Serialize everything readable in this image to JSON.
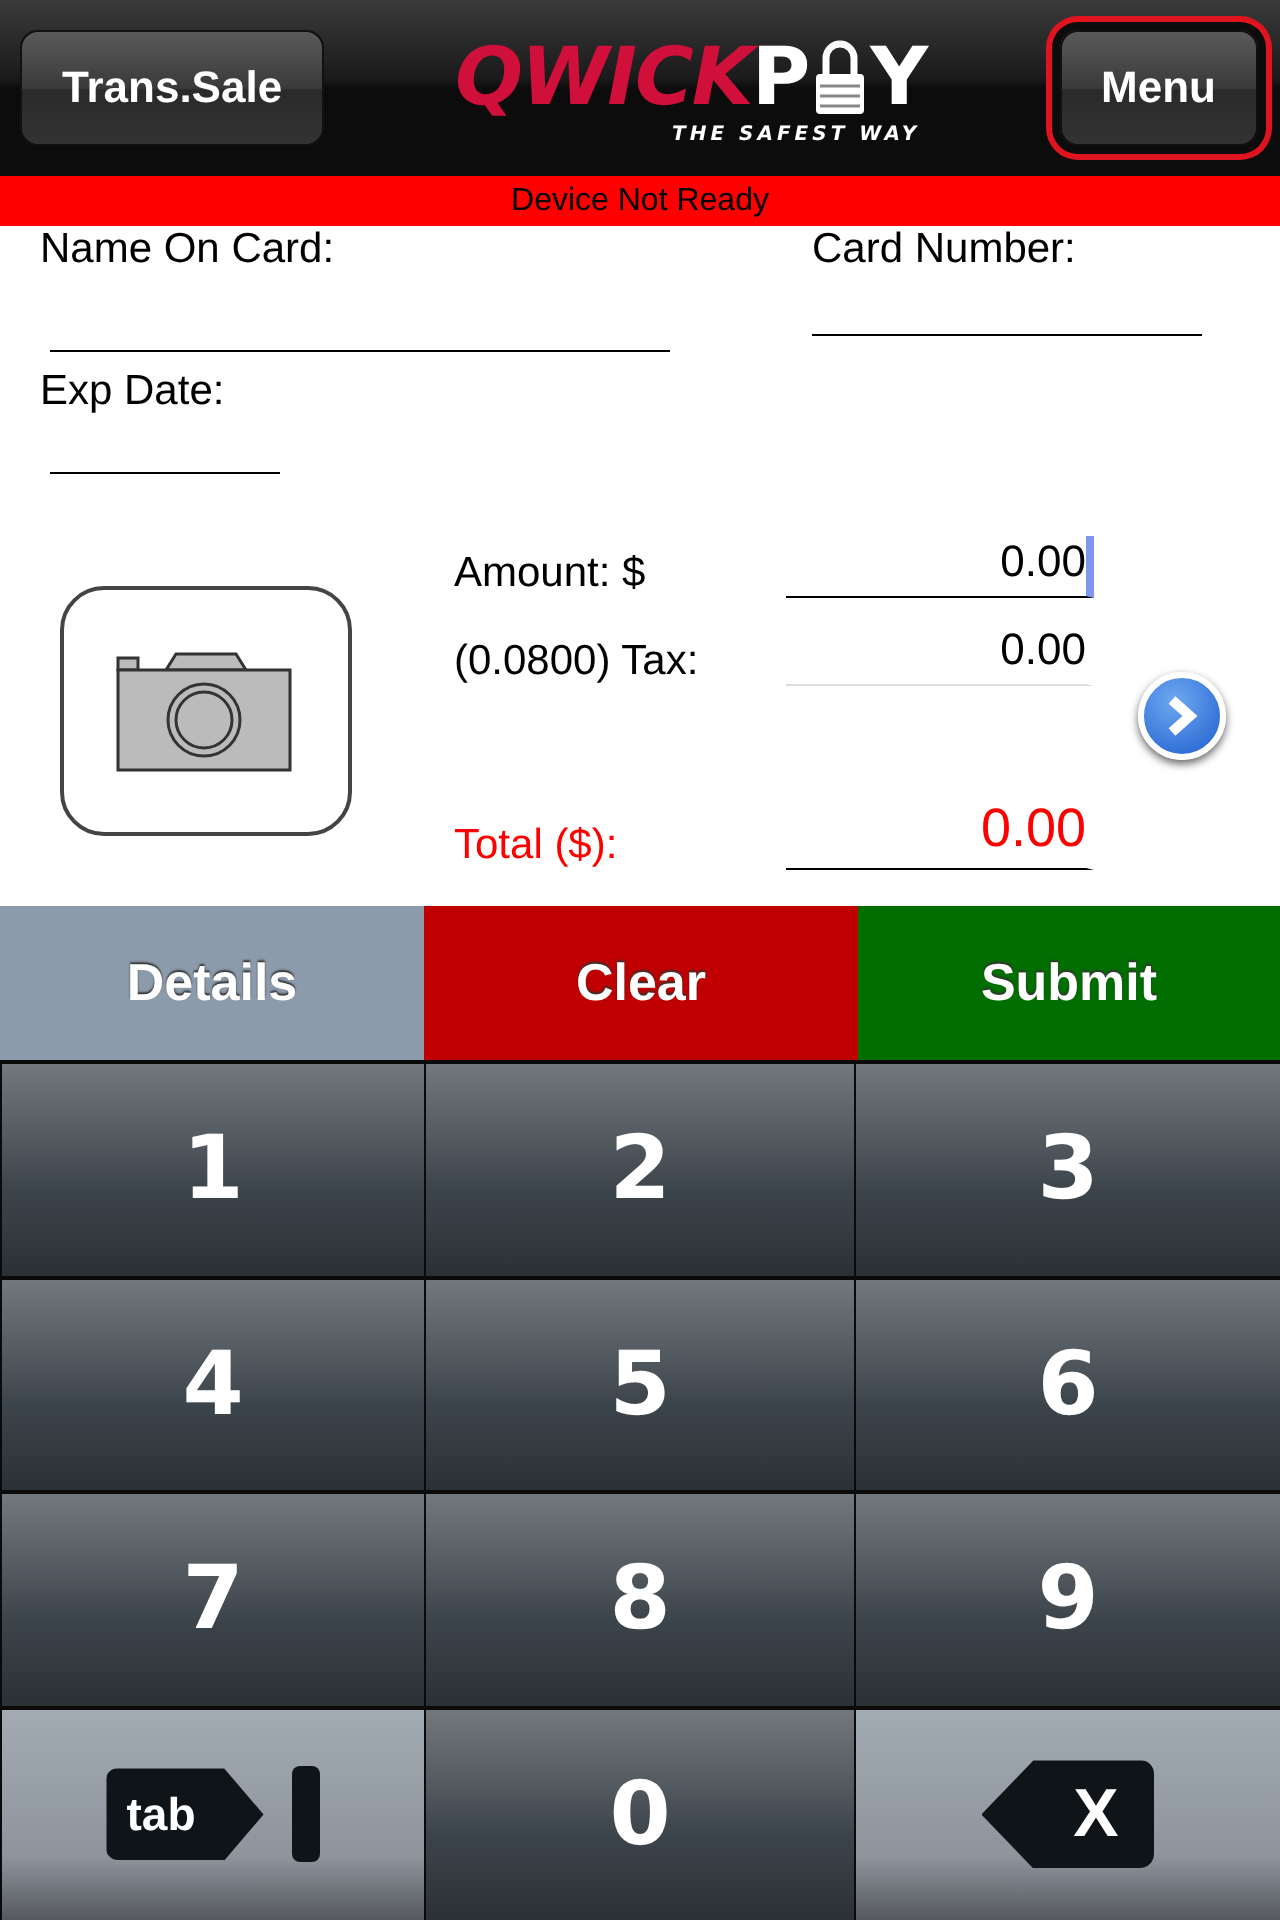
{
  "header": {
    "left_button": "Trans.Sale",
    "logo": {
      "first": "QWICK",
      "second_before": "P",
      "second_after": "Y",
      "tagline": "THE SAFEST WAY"
    },
    "right_button": {
      "label": "Menu",
      "highlighted": true
    }
  },
  "status_banner": "Device Not Ready",
  "card_fields": [
    {
      "label": "Name On Card:"
    },
    {
      "label": "Card Number:"
    },
    {
      "label": "Exp Date:"
    }
  ],
  "amounts": [
    {
      "label": "Amount: $",
      "value": "0.00",
      "focused": true,
      "kind": "plain"
    },
    {
      "label": "(0.0800) Tax:",
      "value": "0.00",
      "focused": false,
      "kind": "plain"
    },
    {
      "label": "Total ($):",
      "value": "0.00",
      "focused": false,
      "kind": "total"
    }
  ],
  "actions": [
    {
      "label": "Details",
      "color": "#8c9bab"
    },
    {
      "label": "Clear",
      "color": "#c00000"
    },
    {
      "label": "Submit",
      "color": "#006e00"
    }
  ],
  "keypad": [
    {
      "label": "1",
      "kind": "digit"
    },
    {
      "label": "2",
      "kind": "digit"
    },
    {
      "label": "3",
      "kind": "digit"
    },
    {
      "label": "4",
      "kind": "digit"
    },
    {
      "label": "5",
      "kind": "digit"
    },
    {
      "label": "6",
      "kind": "digit"
    },
    {
      "label": "7",
      "kind": "digit"
    },
    {
      "label": "8",
      "kind": "digit"
    },
    {
      "label": "9",
      "kind": "digit"
    },
    {
      "label": "tab",
      "kind": "tab"
    },
    {
      "label": "0",
      "kind": "digit"
    },
    {
      "label": "X",
      "kind": "delete"
    }
  ]
}
